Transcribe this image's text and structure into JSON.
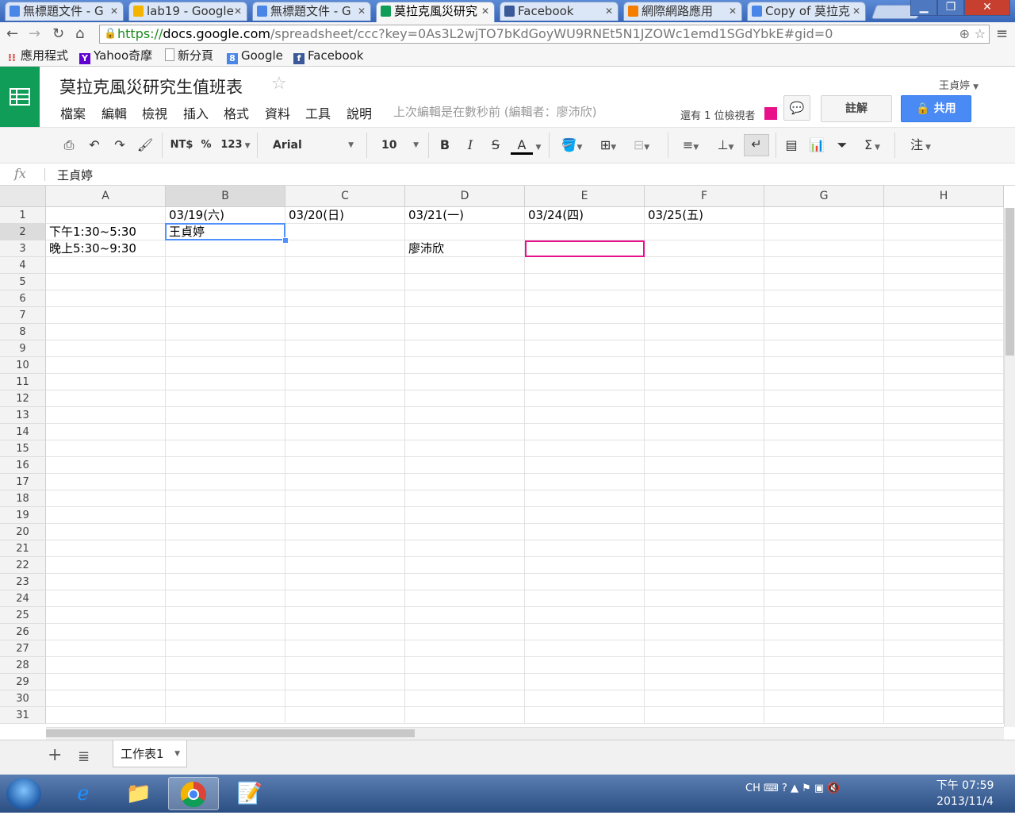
{
  "browser": {
    "tabs": [
      {
        "label": "無標題文件 - G",
        "icon_color": "#4a86e8",
        "icon": "docs-icon"
      },
      {
        "label": "lab19 - Google",
        "icon_color": "#f4b400",
        "icon": "drive-icon"
      },
      {
        "label": "無標題文件 - G",
        "icon_color": "#4a86e8",
        "icon": "docs-icon"
      },
      {
        "label": "莫拉克風災研究",
        "icon_color": "#0f9d58",
        "icon": "sheets-icon",
        "active": true
      },
      {
        "label": "Facebook",
        "icon_color": "#3b5998",
        "icon": "facebook-icon"
      },
      {
        "label": "網際網路應用",
        "icon_color": "#f57d00",
        "icon": "blogger-icon"
      },
      {
        "label": "Copy of 莫拉克",
        "icon_color": "#4a86e8",
        "icon": "docs-icon"
      }
    ],
    "url_scheme": "https://",
    "url_host": "docs.google.com",
    "url_rest": "/spreadsheet/ccc?key=0As3L2wjTO7bKdGoyWU9RNEt5N1JZOWc1emd1SGdYbkE#gid=0",
    "bookmarks": [
      {
        "label": "應用程式",
        "icon": "apps-icon"
      },
      {
        "label": "Yahoo奇摩",
        "icon": "yahoo-icon"
      },
      {
        "label": "新分頁",
        "icon": "page-icon"
      },
      {
        "label": "Google",
        "icon": "google-icon"
      },
      {
        "label": "Facebook",
        "icon": "facebook-icon"
      }
    ]
  },
  "doc": {
    "title": "莫拉克風災研究生值班表",
    "menus": [
      "檔案",
      "編輯",
      "檢視",
      "插入",
      "格式",
      "資料",
      "工具",
      "說明"
    ],
    "last_edit": "上次編輯是在數秒前 (編輯者：廖沛欣)",
    "user": "王貞婷",
    "viewers_text": "還有 1 位檢視者",
    "viewer_color": "#e8118a",
    "note_button": "註解",
    "share_button": "共用"
  },
  "toolbar": {
    "currency": "NT$",
    "percent": "%",
    "number_format": "123",
    "font": "Arial",
    "font_size": "10",
    "bold": "B",
    "italic": "I",
    "strike": "S",
    "text_color": "A",
    "sum": "Σ",
    "note": "注"
  },
  "formula": {
    "fx": "fx",
    "value": "王貞婷"
  },
  "grid": {
    "columns": [
      "A",
      "B",
      "C",
      "D",
      "E",
      "F",
      "G",
      "H"
    ],
    "rows": [
      "1",
      "2",
      "3",
      "4",
      "5",
      "6",
      "7",
      "8",
      "9",
      "10",
      "11",
      "12",
      "13",
      "14",
      "15",
      "16",
      "17",
      "18",
      "19",
      "20",
      "21",
      "22",
      "23",
      "24",
      "25",
      "26",
      "27",
      "28",
      "29",
      "30",
      "31"
    ],
    "cells": [
      [
        "",
        "03/19(六)",
        "03/20(日)",
        "03/21(一)",
        "03/24(四)",
        "03/25(五)",
        "",
        ""
      ],
      [
        "下午1:30~5:30",
        "王貞婷",
        "",
        "",
        "",
        "",
        "",
        ""
      ],
      [
        "晚上5:30~9:30",
        "",
        "",
        "廖沛欣",
        "",
        "",
        "",
        ""
      ]
    ],
    "selected_cell": "B2",
    "collaborator_cell": "E3"
  },
  "sheets": {
    "tabs": [
      "工作表1"
    ]
  },
  "taskbar": {
    "ime": "CH",
    "time": "下午 07:59",
    "date": "2013/11/4"
  }
}
